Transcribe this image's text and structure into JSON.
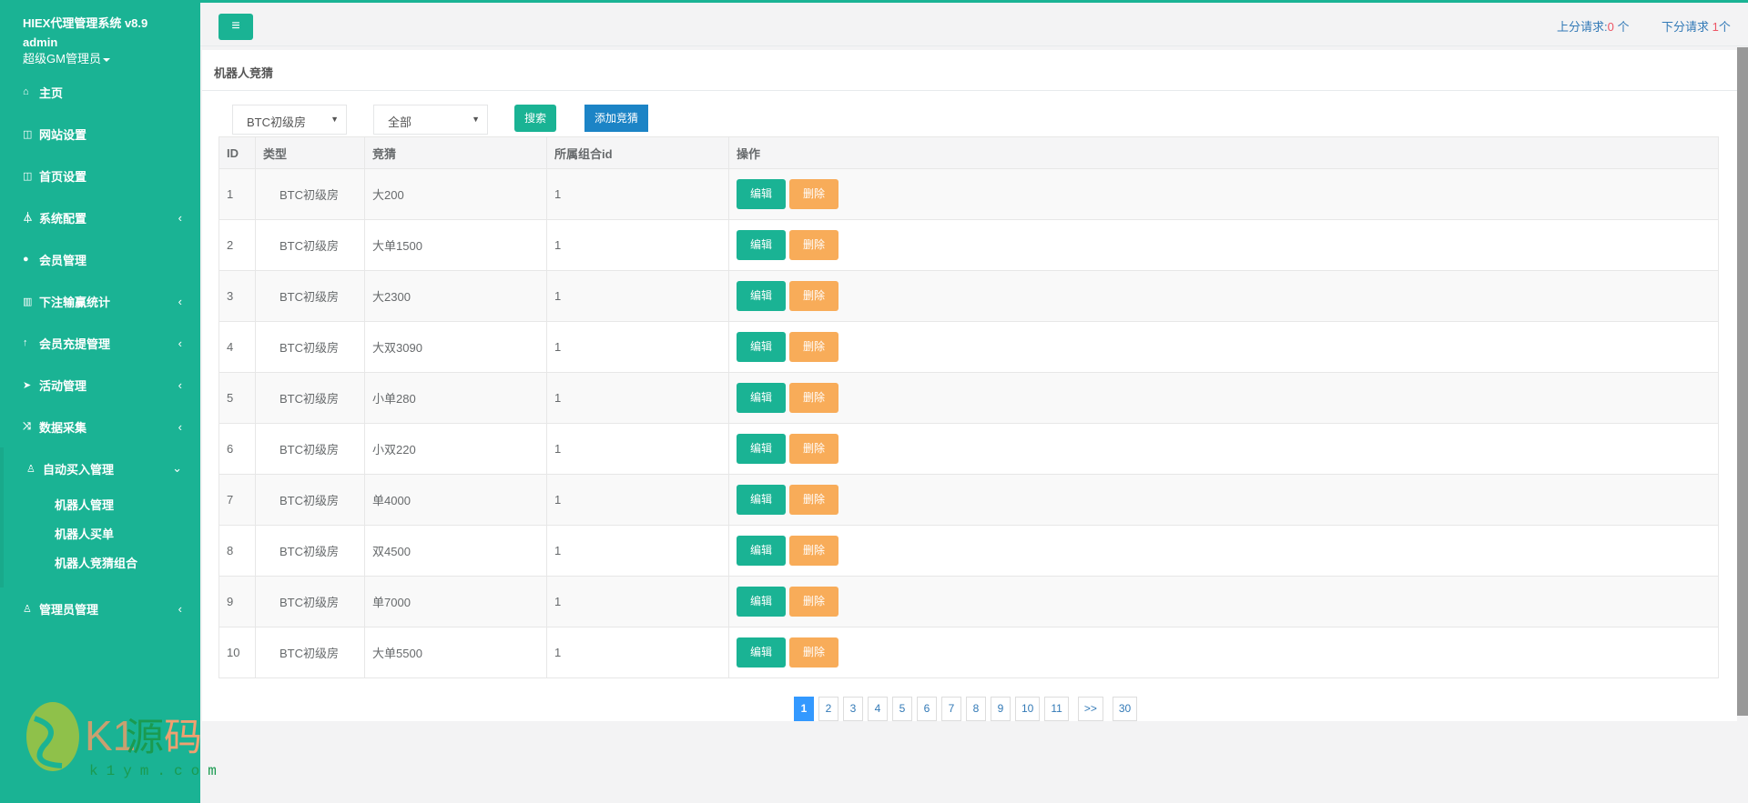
{
  "sidebar": {
    "brand": "HIEX代理管理系统 v8.9",
    "user": "admin",
    "role": "超级GM管理员",
    "items": [
      {
        "label": "主页",
        "icon": "home-icon"
      },
      {
        "label": "网站设置",
        "icon": "columns-icon"
      },
      {
        "label": "首页设置",
        "icon": "columns-icon"
      },
      {
        "label": "系统配置",
        "icon": "flask-icon"
      },
      {
        "label": "会员管理",
        "icon": "user-icon"
      },
      {
        "label": "下注输赢统计",
        "icon": "bar-chart-icon"
      },
      {
        "label": "会员充提管理",
        "icon": "level-up-icon"
      },
      {
        "label": "活动管理",
        "icon": "paper-plane-icon"
      },
      {
        "label": "数据采集",
        "icon": "random-icon"
      },
      {
        "label": "自动买入管理",
        "icon": "male-icon"
      },
      {
        "label": "管理员管理",
        "icon": "male-icon"
      }
    ],
    "subitems": [
      "机器人管理",
      "机器人买单",
      "机器人竞猜组合"
    ],
    "watermark": "K1源码 k1ym.com"
  },
  "header": {
    "up_label": "上分请求:",
    "up_count": "0",
    "up_unit": " 个",
    "down_label": "下分请求 ",
    "down_count": "1",
    "down_unit": "个"
  },
  "panel": {
    "title": "机器人竞猜",
    "filter_type": "BTC初级房",
    "filter_status": "全部",
    "search": "搜索",
    "add": "添加竞猜"
  },
  "table": {
    "headers": [
      "ID",
      "类型",
      "竞猜",
      "所属组合id",
      "操作"
    ],
    "edit": "编辑",
    "delete": "删除",
    "rows": [
      [
        "1",
        "BTC初级房",
        "大200",
        "1"
      ],
      [
        "2",
        "BTC初级房",
        "大单1500",
        "1"
      ],
      [
        "3",
        "BTC初级房",
        "大2300",
        "1"
      ],
      [
        "4",
        "BTC初级房",
        "大双3090",
        "1"
      ],
      [
        "5",
        "BTC初级房",
        "小单280",
        "1"
      ],
      [
        "6",
        "BTC初级房",
        "小双220",
        "1"
      ],
      [
        "7",
        "BTC初级房",
        "单4000",
        "1"
      ],
      [
        "8",
        "BTC初级房",
        "双4500",
        "1"
      ],
      [
        "9",
        "BTC初级房",
        "单7000",
        "1"
      ],
      [
        "10",
        "BTC初级房",
        "大单5500",
        "1"
      ]
    ]
  },
  "pagination": {
    "pages": [
      "1",
      "2",
      "3",
      "4",
      "5",
      "6",
      "7",
      "8",
      "9",
      "10",
      "11"
    ],
    "next": ">>",
    "last": "30",
    "current": "1"
  }
}
